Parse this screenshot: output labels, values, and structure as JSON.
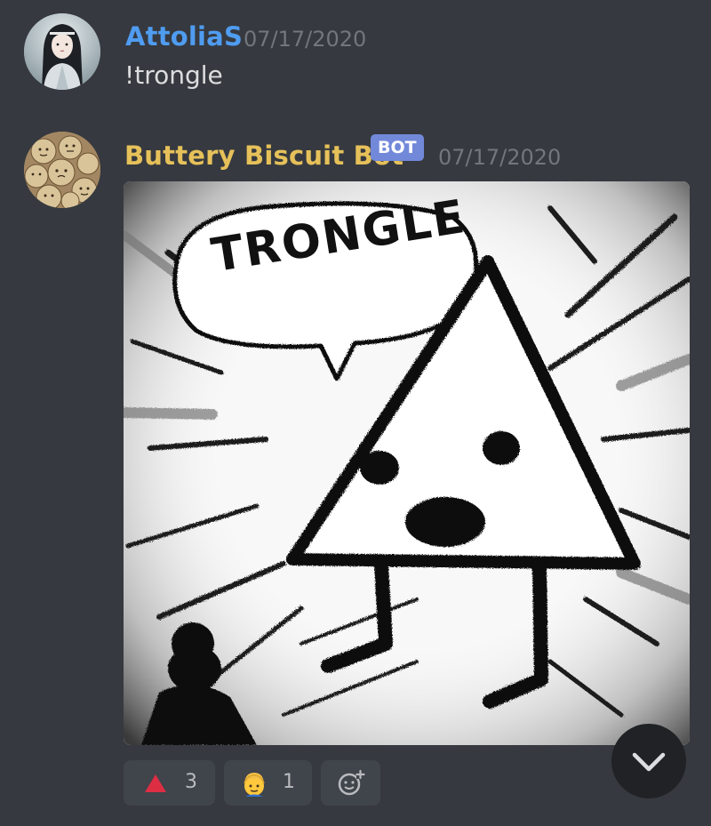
{
  "messages": [
    {
      "username": "AttoliaS",
      "username_color": "#4f9cf0",
      "timestamp": "07/17/2020",
      "content": "!trongle"
    },
    {
      "username": "Buttery Biscuit Bot",
      "username_color": "#e6c15a",
      "bot_tag": "BOT",
      "timestamp": "07/17/2020",
      "attachment": {
        "speech_bubble_text": "TRONGLE"
      }
    }
  ],
  "reactions": [
    {
      "emoji": "red-triangle-up",
      "count": "3"
    },
    {
      "emoji": "person-blond-hair",
      "count": "1"
    },
    {
      "emoji": "add-reaction-icon"
    }
  ],
  "scroll_button": {
    "icon": "chevron-down-icon"
  }
}
